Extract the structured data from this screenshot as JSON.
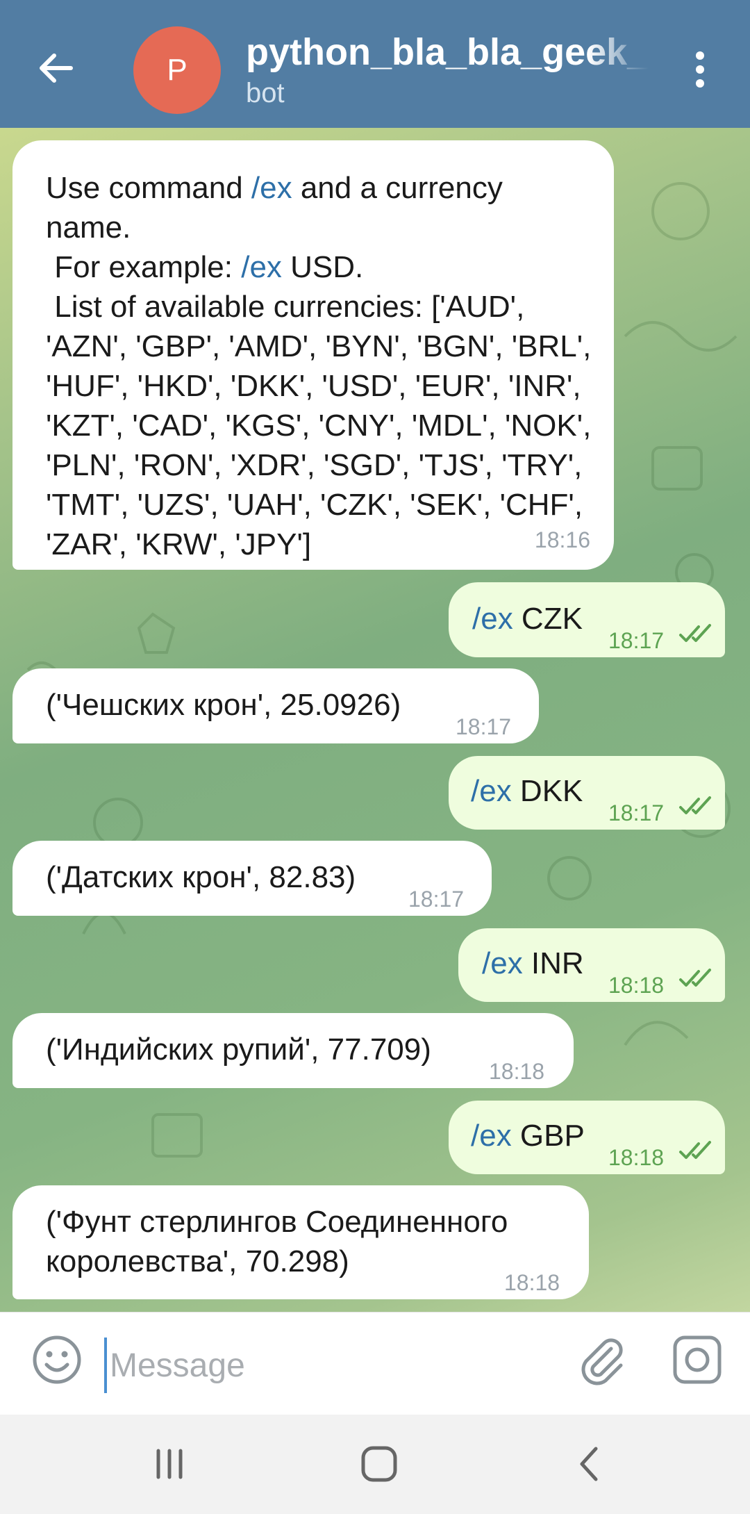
{
  "header": {
    "avatar_letter": "P",
    "title": "python_bla_bla_geek_bot",
    "subtitle": "bot",
    "avatar_color": "#e56a55",
    "bar_color": "#527da3"
  },
  "messages": [
    {
      "direction": "in",
      "lines": [
        [
          {
            "t": "Use command "
          },
          {
            "t": "/ex",
            "cmd": true
          },
          {
            "t": " and a currency"
          }
        ],
        [
          {
            "t": "name."
          }
        ],
        [
          {
            "t": " For example: "
          },
          {
            "t": "/ex",
            "cmd": true
          },
          {
            "t": " USD."
          }
        ],
        [
          {
            "t": " List of available currencies: ['AUD',"
          }
        ],
        [
          {
            "t": "'AZN', 'GBP', 'AMD', 'BYN', 'BGN', 'BRL',"
          }
        ],
        [
          {
            "t": "'HUF', 'HKD', 'DKK', 'USD', 'EUR', 'INR',"
          }
        ],
        [
          {
            "t": "'KZT', 'CAD', 'KGS', 'CNY', 'MDL', 'NOK',"
          }
        ],
        [
          {
            "t": "'PLN', 'RON', 'XDR', 'SGD', 'TJS', 'TRY',"
          }
        ],
        [
          {
            "t": "'TMT', 'UZS', 'UAH', 'CZK', 'SEK', 'CHF',"
          }
        ],
        [
          {
            "t": "'ZAR', 'KRW', 'JPY']"
          }
        ]
      ],
      "time": "18:16"
    },
    {
      "direction": "out",
      "cmd": "/ex",
      "arg": " CZK",
      "time": "18:17"
    },
    {
      "direction": "in",
      "lines": [
        [
          {
            "t": "('Чешских крон', 25.0926)"
          }
        ]
      ],
      "time": "18:17"
    },
    {
      "direction": "out",
      "cmd": "/ex",
      "arg": " DKK",
      "time": "18:17"
    },
    {
      "direction": "in",
      "lines": [
        [
          {
            "t": "('Датских крон', 82.83)"
          }
        ]
      ],
      "time": "18:17"
    },
    {
      "direction": "out",
      "cmd": "/ex",
      "arg": " INR",
      "time": "18:18"
    },
    {
      "direction": "in",
      "lines": [
        [
          {
            "t": "('Индийских рупий', 77.709)"
          }
        ]
      ],
      "time": "18:18"
    },
    {
      "direction": "out",
      "cmd": "/ex",
      "arg": " GBP",
      "time": "18:18"
    },
    {
      "direction": "in",
      "lines": [
        [
          {
            "t": "('Фунт стерлингов Соединенного"
          }
        ],
        [
          {
            "t": "королевства', 70.298)"
          }
        ]
      ],
      "time": "18:18"
    }
  ],
  "input": {
    "placeholder": "Message",
    "value": ""
  },
  "icons": {
    "back": "arrow-left-icon",
    "menu": "more-vertical-icon",
    "emoji": "smiley-icon",
    "attach": "paperclip-icon",
    "camera": "camera-icon",
    "read": "double-check-icon",
    "nav_recents": "recents-icon",
    "nav_home": "home-icon",
    "nav_back": "chevron-left-icon"
  },
  "colors": {
    "incoming_bubble": "#ffffff",
    "outgoing_bubble": "#effdde",
    "command_link": "#2d6fa8",
    "outgoing_time": "#5da352",
    "incoming_time": "#9aa3ab"
  }
}
